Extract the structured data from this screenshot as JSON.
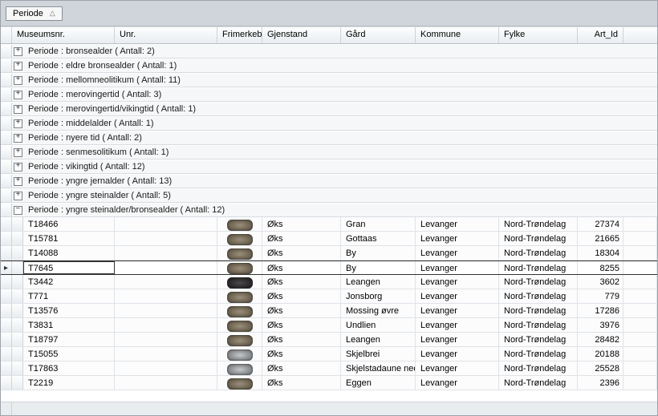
{
  "group": {
    "field": "Periode"
  },
  "columns": {
    "museum": "Museumsnr.",
    "unr": "Unr.",
    "frim": "Frimerkebilde",
    "gjen": "Gjenstand",
    "gard": "Gård",
    "komm": "Kommune",
    "fylke": "Fylke",
    "art": "Art_Id"
  },
  "group_label_prefix": "Periode : ",
  "group_count_prefix": " ( Antall: ",
  "group_count_suffix": ")",
  "groups": [
    {
      "name": "bronsealder",
      "count": 2,
      "expanded": false
    },
    {
      "name": "eldre bronsealder",
      "count": 1,
      "expanded": false
    },
    {
      "name": "mellomneolitikum",
      "count": 11,
      "expanded": false
    },
    {
      "name": "merovingertid",
      "count": 3,
      "expanded": false
    },
    {
      "name": "merovingertid/vikingtid",
      "count": 1,
      "expanded": false
    },
    {
      "name": "middelalder",
      "count": 1,
      "expanded": false
    },
    {
      "name": "nyere tid",
      "count": 2,
      "expanded": false
    },
    {
      "name": "senmesolitikum",
      "count": 1,
      "expanded": false
    },
    {
      "name": "vikingtid",
      "count": 12,
      "expanded": false
    },
    {
      "name": "yngre jernalder",
      "count": 13,
      "expanded": false
    },
    {
      "name": "yngre steinalder",
      "count": 5,
      "expanded": false
    },
    {
      "name": "yngre steinalder/bronsealder",
      "count": 12,
      "expanded": true
    }
  ],
  "rows": [
    {
      "museum": "T18466",
      "unr": "",
      "thumb": "norm",
      "gjen": "Øks",
      "gard": "Gran",
      "komm": "Levanger",
      "fylke": "Nord-Trøndelag",
      "art": 27374
    },
    {
      "museum": "T15781",
      "unr": "",
      "thumb": "norm",
      "gjen": "Øks",
      "gard": "Gottaas",
      "komm": "Levanger",
      "fylke": "Nord-Trøndelag",
      "art": 21665
    },
    {
      "museum": "T14088",
      "unr": "",
      "thumb": "norm",
      "gjen": "Øks",
      "gard": "By",
      "komm": "Levanger",
      "fylke": "Nord-Trøndelag",
      "art": 18304
    },
    {
      "museum": "T7645",
      "unr": "",
      "thumb": "norm",
      "gjen": "Øks",
      "gard": "By",
      "komm": "Levanger",
      "fylke": "Nord-Trøndelag",
      "art": 8255,
      "focused": true
    },
    {
      "museum": "T3442",
      "unr": "",
      "thumb": "dark",
      "gjen": "Øks",
      "gard": "Leangen",
      "komm": "Levanger",
      "fylke": "Nord-Trøndelag",
      "art": 3602
    },
    {
      "museum": "T771",
      "unr": "",
      "thumb": "norm",
      "gjen": "Øks",
      "gard": "Jonsborg",
      "komm": "Levanger",
      "fylke": "Nord-Trøndelag",
      "art": 779
    },
    {
      "museum": "T13576",
      "unr": "",
      "thumb": "norm",
      "gjen": "Øks",
      "gard": "Mossing øvre",
      "komm": "Levanger",
      "fylke": "Nord-Trøndelag",
      "art": 17286
    },
    {
      "museum": "T3831",
      "unr": "",
      "thumb": "norm",
      "gjen": "Øks",
      "gard": "Undlien",
      "komm": "Levanger",
      "fylke": "Nord-Trøndelag",
      "art": 3976
    },
    {
      "museum": "T18797",
      "unr": "",
      "thumb": "norm",
      "gjen": "Øks",
      "gard": "Leangen",
      "komm": "Levanger",
      "fylke": "Nord-Trøndelag",
      "art": 28482
    },
    {
      "museum": "T15055",
      "unr": "",
      "thumb": "grey",
      "gjen": "Øks",
      "gard": "Skjelbrei",
      "komm": "Levanger",
      "fylke": "Nord-Trøndelag",
      "art": 20188
    },
    {
      "museum": "T17863",
      "unr": "",
      "thumb": "grey",
      "gjen": "Øks",
      "gard": "Skjelstadaune nedre",
      "komm": "Levanger",
      "fylke": "Nord-Trøndelag",
      "art": 25528
    },
    {
      "museum": "T2219",
      "unr": "",
      "thumb": "norm",
      "gjen": "Øks",
      "gard": "Eggen",
      "komm": "Levanger",
      "fylke": "Nord-Trøndelag",
      "art": 2396
    }
  ]
}
